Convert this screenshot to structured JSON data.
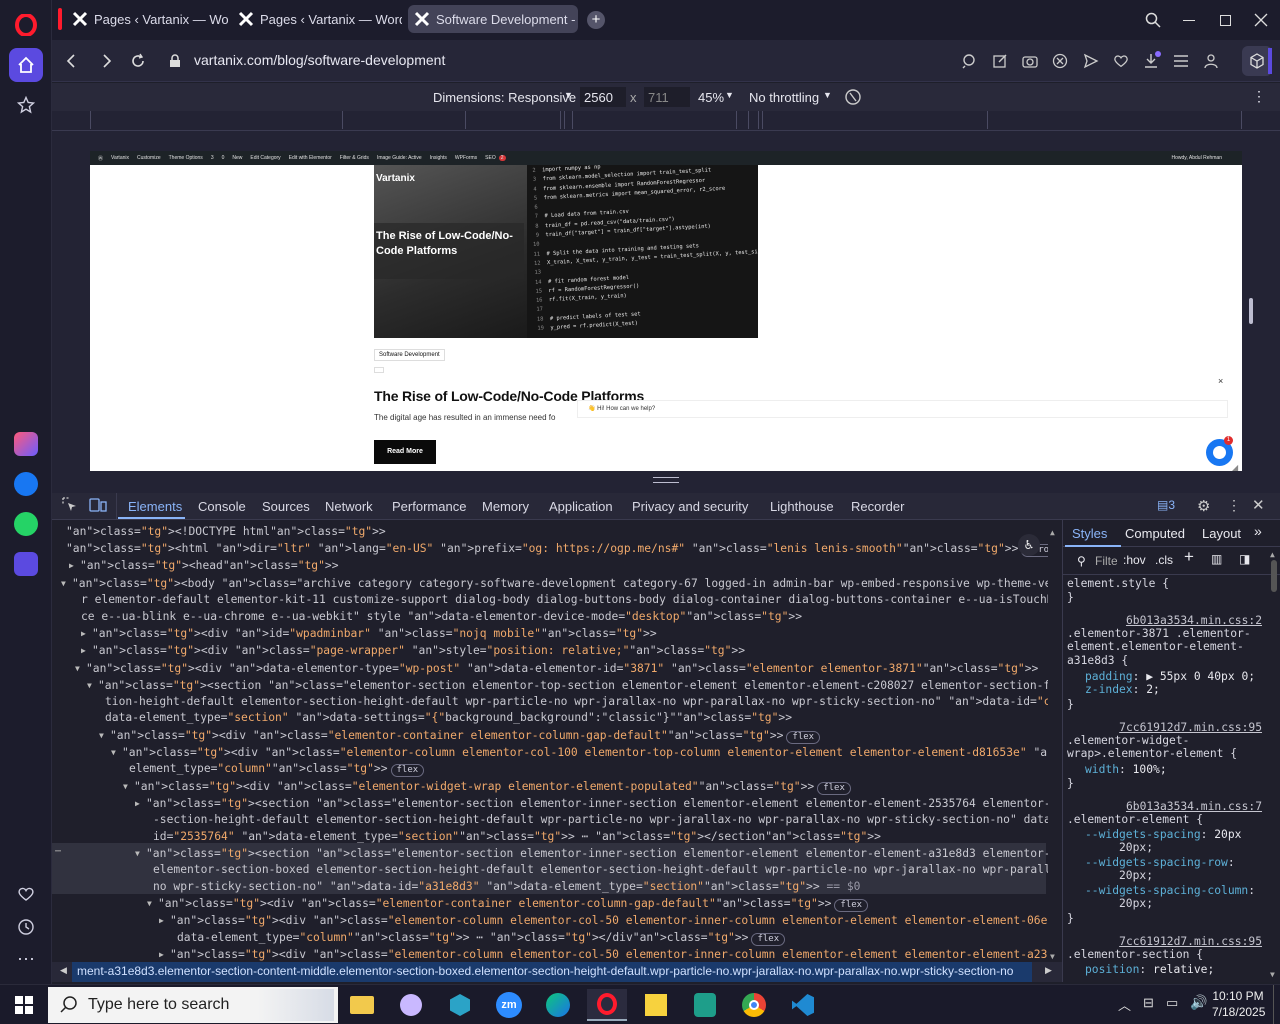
{
  "browser": {
    "tabs": [
      {
        "label": "Pages ‹ Vartanix — WordP"
      },
      {
        "label": "Pages ‹ Vartanix — WordP"
      },
      {
        "label": "Software Development - V"
      }
    ],
    "url": "vartanix.com/blog/software-development"
  },
  "device_toolbar": {
    "dimensions_label": "Dimensions: Responsive",
    "width": "2560",
    "x": "x",
    "height": "711",
    "zoom": "45%",
    "throttling": "No throttling"
  },
  "wp_admin_bar": {
    "items": [
      "Vartanix",
      "Customize",
      "Theme Options",
      "3",
      "0",
      "New",
      "Edit Category",
      "Edit with Elementor",
      "Filter & Grids",
      "Image Guide: Active",
      "Insights",
      "WPForms",
      "SEO"
    ],
    "seo_badge": "2",
    "greeting": "Howdy, Abdul Rehman"
  },
  "page": {
    "logo": "Vartanix",
    "hero_title": "The Rise of Low-Code/No-Code Platforms",
    "category_tag": "Software Development",
    "post_title": "The Rise of Low-Code/No-Code Platforms",
    "excerpt": "The digital age has resulted in an immense need fo",
    "read_more": "Read More",
    "chat_prompt": "👋 Hi! How can we help?",
    "chat_close": "×",
    "chat_badge": "1",
    "code_lines": [
      {
        "n": "2",
        "t": "import numpy as np"
      },
      {
        "n": "3",
        "t": "from sklearn.model_selection import train_test_split"
      },
      {
        "n": "4",
        "t": "from sklearn.ensemble import RandomForestRegressor"
      },
      {
        "n": "5",
        "t": "from sklearn.metrics import mean_squared_error, r2_score"
      },
      {
        "n": "6",
        "t": ""
      },
      {
        "n": "7",
        "t": "# Load data from train.csv"
      },
      {
        "n": "8",
        "t": "train_df = pd.read_csv(\"data/train.csv\")"
      },
      {
        "n": "9",
        "t": "train_df[\"target\"] = train_df[\"target\"].astype(int)"
      },
      {
        "n": "10",
        "t": ""
      },
      {
        "n": "11",
        "t": "# Split the data into training and testing sets"
      },
      {
        "n": "12",
        "t": "X_train, X_test, y_train, y_test = train_test_split(X, y, test_size=0.2)"
      },
      {
        "n": "13",
        "t": ""
      },
      {
        "n": "14",
        "t": "# fit random forest model"
      },
      {
        "n": "15",
        "t": "rf = RandomForestRegressor()"
      },
      {
        "n": "16",
        "t": "rf.fit(X_train, y_train)"
      },
      {
        "n": "17",
        "t": ""
      },
      {
        "n": "18",
        "t": "# predict labels of test set"
      },
      {
        "n": "19",
        "t": "y_pred = rf.predict(X_test)"
      }
    ]
  },
  "devtools": {
    "tabs": [
      "Elements",
      "Console",
      "Sources",
      "Network",
      "Performance",
      "Memory",
      "Application",
      "Privacy and security",
      "Lighthouse",
      "Recorder"
    ],
    "issues_count": "3",
    "side_tabs": [
      "Styles",
      "Computed",
      "Layout"
    ],
    "filter_placeholder": "Filter",
    "hov": ":hov",
    "cls": ".cls",
    "breadcrumb": "ment-a31e8d3.elementor-section-content-middle.elementor-section-boxed.elementor-section-height-default.wpr-particle-no.wpr-jarallax-no.wpr-parallax-no.wpr-sticky-section-no",
    "dom_lines": [
      "<!DOCTYPE html>",
      "<html dir=\"ltr\" lang=\"en-US\" prefix=\"og: https://ogp.me/ns#\" class=\"lenis lenis-smooth\">",
      "<head>",
      "<body class=\"archive category category-software-development category-67 logged-in admin-bar wp-embed-responsive wp-theme-vertexify hfeed no-sideba",
      "r elementor-default elementor-kit-11 customize-support dialog-body dialog-buttons-body dialog-container dialog-buttons-container e--ua-isTouchDevi",
      "ce e--ua-blink e--ua-chrome e--ua-webkit\" style data-elementor-device-mode=\"desktop\">",
      "<div id=\"wpadminbar\" class=\"nojq mobile\">",
      "<div class=\"page-wrapper\" style=\"position: relative;\">",
      "<div data-elementor-type=\"wp-post\" data-elementor-id=\"3871\" class=\"elementor elementor-3871\">",
      "<section class=\"elementor-section elementor-top-section elementor-element elementor-element-c208027 elementor-section-full_width elementor-sec",
      "tion-height-default elementor-section-height-default wpr-particle-no wpr-jarallax-no wpr-parallax-no wpr-sticky-section-no\" data-id=\"c208027\"",
      "data-element_type=\"section\" data-settings=\"{\"background_background\":\"classic\"}\">",
      "<div class=\"elementor-container elementor-column-gap-default\">",
      "<div class=\"elementor-column elementor-col-100 elementor-top-column elementor-element elementor-element-d81653e\" data-id=\"d81653e\" data-",
      "element_type=\"column\">",
      "<div class=\"elementor-widget-wrap elementor-element-populated\">",
      "<section class=\"elementor-section elementor-inner-section elementor-element elementor-element-2535764 elementor-section-boxed elementor",
      "-section-height-default elementor-section-height-default wpr-particle-no wpr-jarallax-no wpr-parallax-no wpr-sticky-section-no\" data-",
      "id=\"2535764\" data-element_type=\"section\"> ⋯ </section>",
      "<section class=\"elementor-section elementor-inner-section elementor-element elementor-element-a31e8d3 elementor-section-content-middle",
      "elementor-section-boxed elementor-section-height-default elementor-section-height-default wpr-particle-no wpr-jarallax-no wpr-parallax-",
      "no wpr-sticky-section-no\" data-id=\"a31e8d3\" data-element_type=\"section\"> == $0",
      "<div class=\"elementor-container elementor-column-gap-default\">",
      "<div class=\"elementor-column elementor-col-50 elementor-inner-column elementor-element elementor-element-06e15d8\" data-id=\"06e15d8\"",
      "data-element_type=\"column\"> ⋯ </div>",
      "<div class=\"elementor-column elementor-col-50 elementor-inner-column elementor-element elementor-element-a23c1f8\" data-id=\"a23c1f8\""
    ],
    "pills": {
      "scroll": "scroll",
      "flex": "flex"
    },
    "styles": [
      "element.style {",
      "}",
      "6b013a3534.min.css:2",
      ".elementor-3871 .elementor-",
      "element.elementor-element-",
      "a31e8d3 {",
      "padding: ▶ 55px 0 40px 0;",
      "z-index: 2;",
      "}",
      "7cc61912d7.min.css:95",
      ".elementor-widget-",
      "wrap>.elementor-element {",
      "width: 100%;",
      "}",
      "6b013a3534.min.css:7",
      ".elementor-element {",
      "--widgets-spacing: 20px",
      "20px;",
      "--widgets-spacing-row:",
      "20px;",
      "--widgets-spacing-column:",
      "20px;",
      "}",
      "7cc61912d7.min.css:95",
      ".elementor-section {",
      "position: relative;"
    ]
  },
  "taskbar": {
    "search_placeholder": "Type here to search",
    "time": "10:10 PM",
    "date": "7/18/2025"
  },
  "colors": {
    "opera_red": "#ff1b2d",
    "accent": "#8ab4f8",
    "selection": "#31323f"
  }
}
